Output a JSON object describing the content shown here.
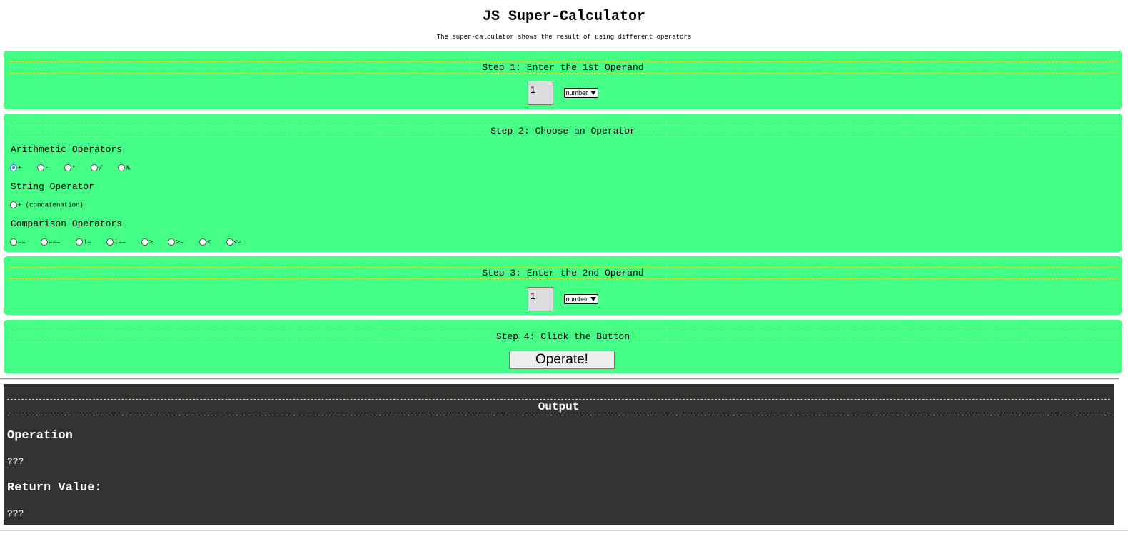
{
  "header": {
    "title": "JS Super-Calculator",
    "subtitle": "The super-calculator shows the result of using different operators"
  },
  "step1": {
    "heading": "Step 1: Enter the 1st Operand",
    "operand_value": "1",
    "type_selected": "number"
  },
  "step2": {
    "heading": "Step 2: Choose an Operator",
    "arithmetic_label": "Arithmetic Operators",
    "arithmetic": [
      "+",
      "-",
      "*",
      "/",
      "%"
    ],
    "arithmetic_selected": "+",
    "string_label": "String Operator",
    "string_ops": [
      "+ (concatenation)"
    ],
    "comparison_label": "Comparison Operators",
    "comparison": [
      "==",
      "===",
      "!=",
      "!==",
      ">",
      ">=",
      "<",
      "<="
    ]
  },
  "step3": {
    "heading": "Step 3: Enter the 2nd Operand",
    "operand_value": "1",
    "type_selected": "number"
  },
  "step4": {
    "heading": "Step 4: Click the Button",
    "button_label": "Operate!"
  },
  "output": {
    "heading": "Output",
    "operation_label": "Operation",
    "operation_value": "???",
    "return_label": "Return Value:",
    "return_value": "???"
  },
  "colors": {
    "panel": "#45ff87",
    "output_bg": "#333333",
    "dash": "#e4e400"
  }
}
